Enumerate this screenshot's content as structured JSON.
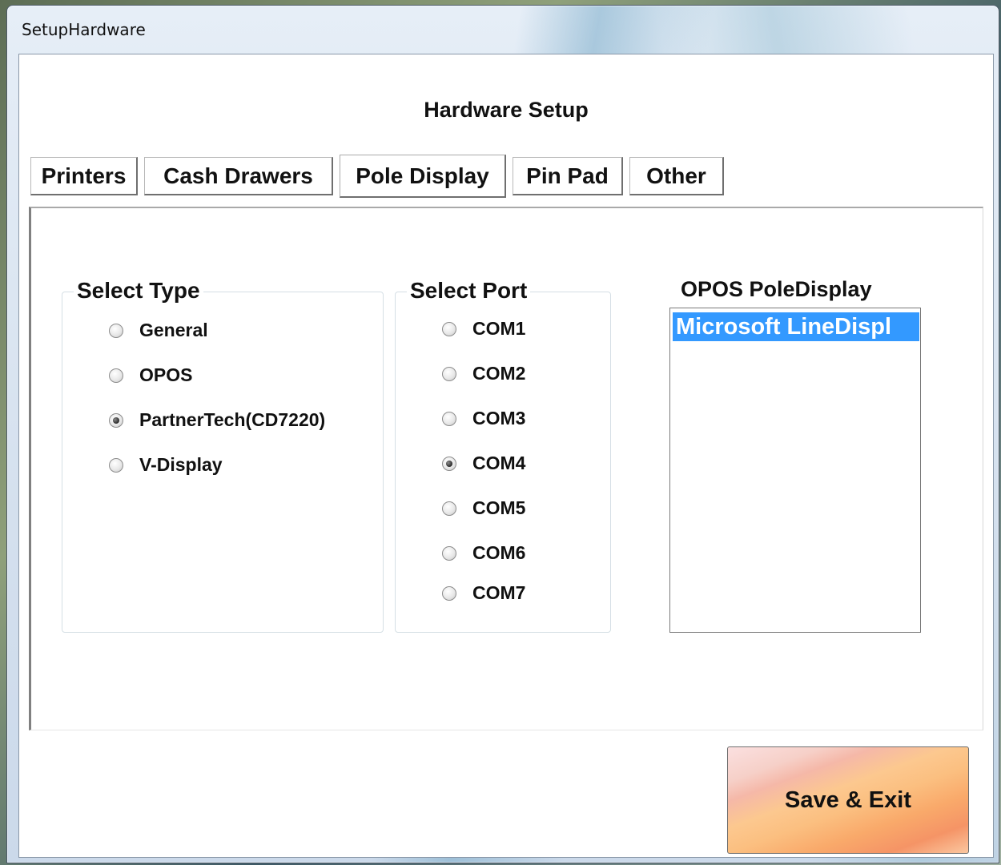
{
  "window": {
    "title": "SetupHardware"
  },
  "form": {
    "heading": "Hardware Setup"
  },
  "tabs": [
    {
      "label": "Printers",
      "active": false
    },
    {
      "label": "Cash Drawers",
      "active": false
    },
    {
      "label": "Pole Display",
      "active": true
    },
    {
      "label": "Pin Pad",
      "active": false
    },
    {
      "label": "Other",
      "active": false
    }
  ],
  "select_type": {
    "title": "Select Type",
    "options": [
      "General",
      "OPOS",
      "PartnerTech(CD7220)",
      "V-Display"
    ],
    "selected": "PartnerTech(CD7220)"
  },
  "select_port": {
    "title": "Select Port",
    "options": [
      "COM1",
      "COM2",
      "COM3",
      "COM4",
      "COM5",
      "COM6",
      "COM7"
    ],
    "selected": "COM4"
  },
  "opos_pole_display": {
    "title": "OPOS PoleDisplay",
    "items": [
      "Microsoft LineDispl"
    ],
    "selected": "Microsoft LineDispl"
  },
  "buttons": {
    "save_exit": "Save & Exit"
  }
}
